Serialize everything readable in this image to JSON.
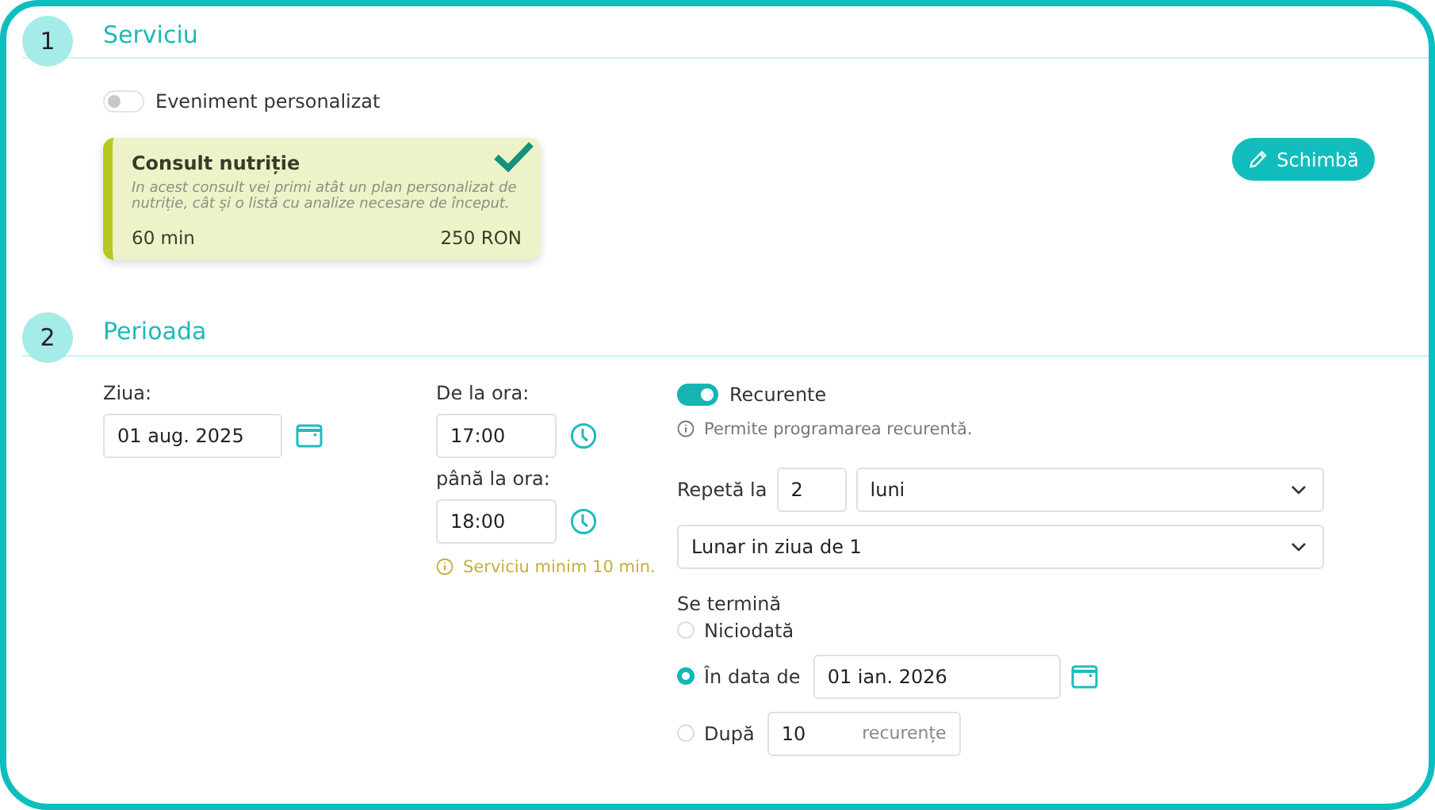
{
  "sections": [
    {
      "kind": "service",
      "number": "1",
      "title": "Serviciu",
      "custom_event": {
        "label": "Eveniment personalizat",
        "on": false
      },
      "service_card": {
        "title": "Consult nutriție",
        "description": "In acest consult vei primi atât un plan personalizat de nutriție, cât și o listă cu analize necesare de început.",
        "duration": "60 min",
        "price": "250 RON",
        "selected": true
      },
      "change_button": "Schimbă"
    },
    {
      "kind": "period",
      "number": "2",
      "title": "Perioada",
      "day": {
        "label": "Ziua:",
        "value": "01 aug. 2025"
      },
      "from": {
        "label": "De la ora:",
        "value": "17:00"
      },
      "to": {
        "label": "până la ora:",
        "value": "18:00"
      },
      "duration_hint": "Serviciu minim 10 min.",
      "recurring": {
        "label": "Recurente",
        "on": true,
        "hint": "Permite programarea recurentă.",
        "repeat_label": "Repetă la",
        "repeat_count": "2",
        "repeat_unit": "luni",
        "pattern": "Lunar in ziua de 1",
        "end_label": "Se termină",
        "end_options": [
          {
            "kind": "never",
            "label": "Niciodată",
            "selected": false
          },
          {
            "kind": "date",
            "label": "În data de",
            "value": "01 ian. 2026",
            "selected": true
          },
          {
            "kind": "count",
            "label": "După",
            "value": "10",
            "suffix": "recurențe",
            "selected": false
          }
        ]
      }
    }
  ]
}
